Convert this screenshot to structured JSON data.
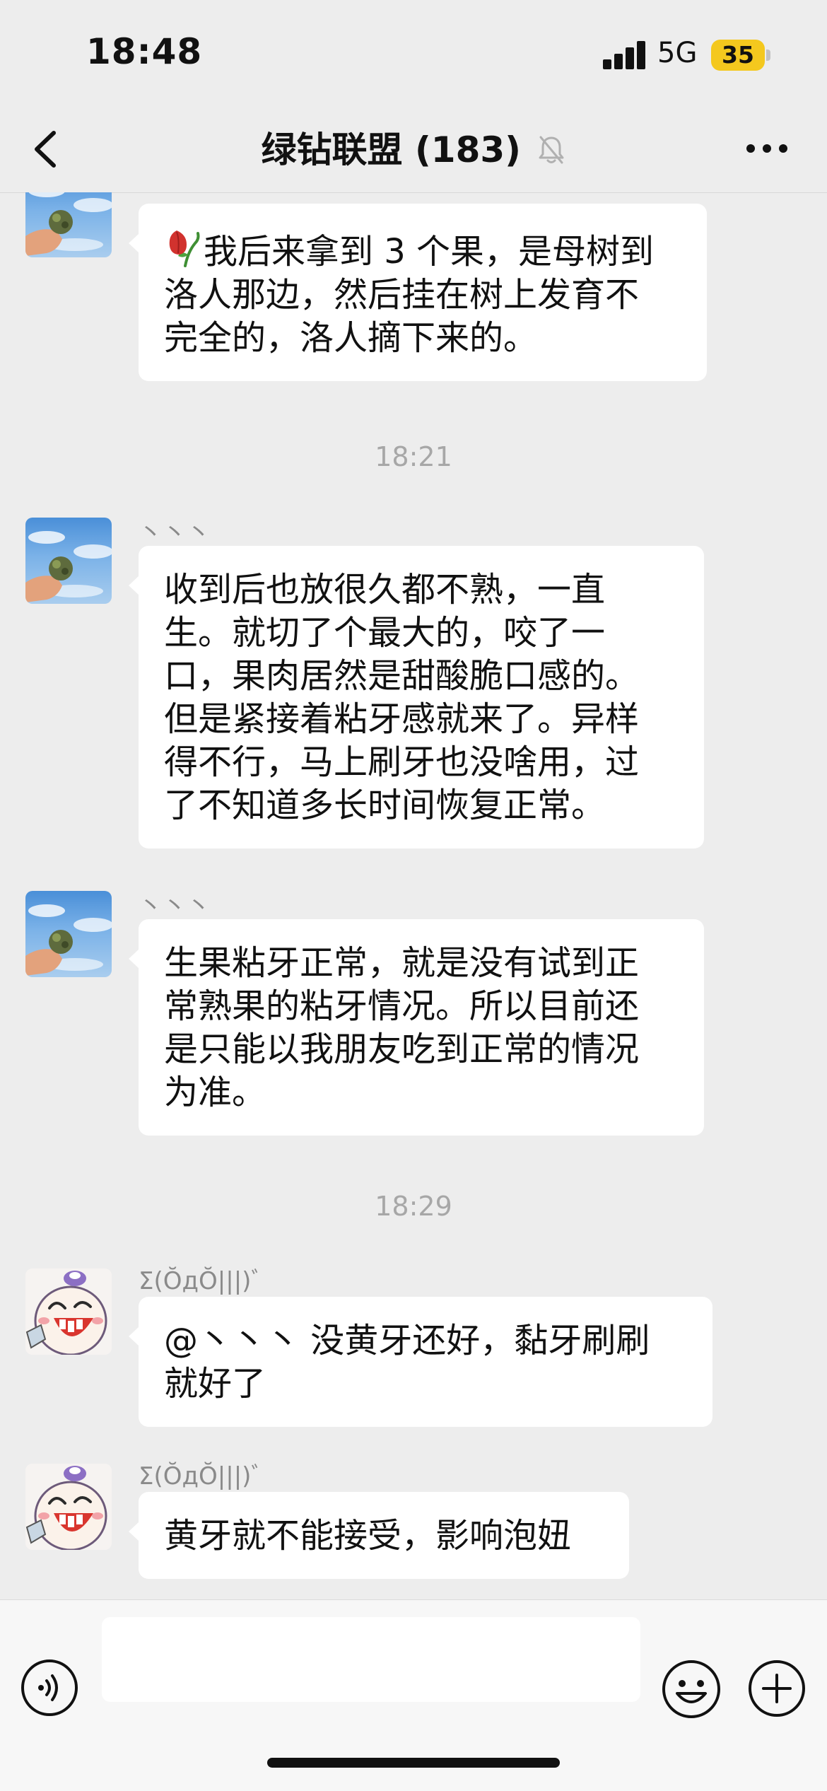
{
  "status_bar": {
    "time": "18:48",
    "network": "5G",
    "battery": "35",
    "battery_color": "#f4c81e"
  },
  "header": {
    "back_icon": "chevron-left-icon",
    "title": "绿钻联盟 (183)",
    "mute_icon": "bell-muted-icon",
    "more_icon": "ellipsis-icon"
  },
  "messages": [
    {
      "sender": "丶丶丶",
      "avatar": "sky-hand-avatar",
      "lines": [
        "我后来拿到 3 个果，是母树到",
        "洛人那边，然后挂在树上发育不",
        "完全的，洛人摘下来的。"
      ],
      "leading_icon": "wilted-flower-icon"
    },
    {
      "timestamp": "18:21"
    },
    {
      "sender": "丶丶丶",
      "avatar": "sky-hand-avatar",
      "lines": [
        "收到后也放很久都不熟，一直",
        "生。就切了个最大的，咬了一",
        "口，果肉居然是甜酸脆口感的。",
        "但是紧接着粘牙感就来了。异样",
        "得不行，马上刷牙也没啥用，过",
        "了不知道多长时间恢复正常。"
      ]
    },
    {
      "sender": "丶丶丶",
      "avatar": "sky-hand-avatar",
      "lines": [
        "生果粘牙正常，就是没有试到正",
        "常熟果的粘牙情况。所以目前还",
        "是只能以我朋友吃到正常的情况",
        "为准。"
      ]
    },
    {
      "timestamp": "18:29"
    },
    {
      "sender": "Σ(ŎдŎ|||)ﾞ",
      "avatar": "cartoon-avatar",
      "lines": [
        "@丶丶丶 没黄牙还好，黏牙刷刷",
        "就好了"
      ]
    },
    {
      "sender": "Σ(ŎдŎ|||)ﾞ",
      "avatar": "cartoon-avatar",
      "lines": [
        "黄牙就不能接受，影响泡妞"
      ]
    }
  ],
  "input_bar": {
    "voice_icon": "voice-icon",
    "emoji_icon": "emoji-icon",
    "plus_icon": "plus-icon",
    "input_value": ""
  }
}
